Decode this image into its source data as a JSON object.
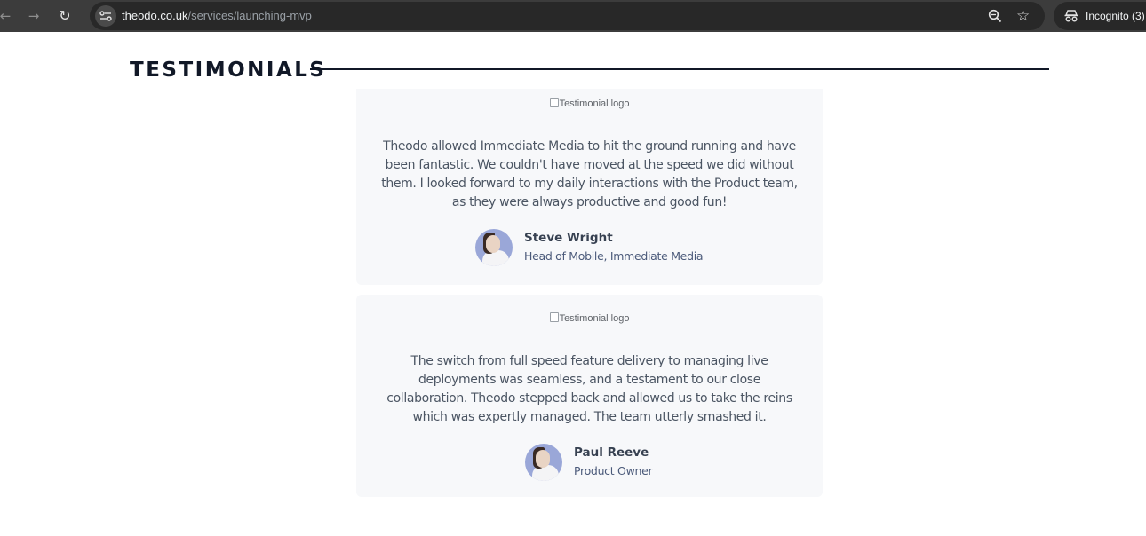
{
  "browser": {
    "url_host": "theodo.co.uk",
    "url_path": "/services/launching-mvp",
    "incognito_label": "Incognito (3)",
    "icons": [
      "back-arrow-icon",
      "forward-arrow-icon",
      "reload-icon",
      "site-info-icon",
      "zoom-icon",
      "star-icon",
      "incognito-icon"
    ]
  },
  "section": {
    "title": "TESTIMONIALS"
  },
  "testimonials": [
    {
      "logo_alt": "Testimonial logo",
      "quote": "Theodo allowed Immediate Media to hit the ground running and have been fantastic. We couldn't have moved at the speed we did without them. I looked forward to my daily interactions with the Product team, as they were always productive and good fun!",
      "name": "Steve Wright",
      "role": "Head of Mobile, Immediate Media"
    },
    {
      "logo_alt": "Testimonial logo",
      "quote": "The switch from full speed feature delivery to managing live deployments was seamless, and a testament to our close collaboration. Theodo stepped back and allowed us to take the reins which was expertly managed. The team utterly smashed it.",
      "name": "Paul Reeve",
      "role": "Product Owner"
    }
  ],
  "colors": {
    "chrome_bg": "#3c3c3c",
    "omnibox_bg": "#282828",
    "card_bg": "#f7f8fa",
    "title": "#111827",
    "quote_text": "#4b5563",
    "role_text": "#4b5a7a"
  }
}
